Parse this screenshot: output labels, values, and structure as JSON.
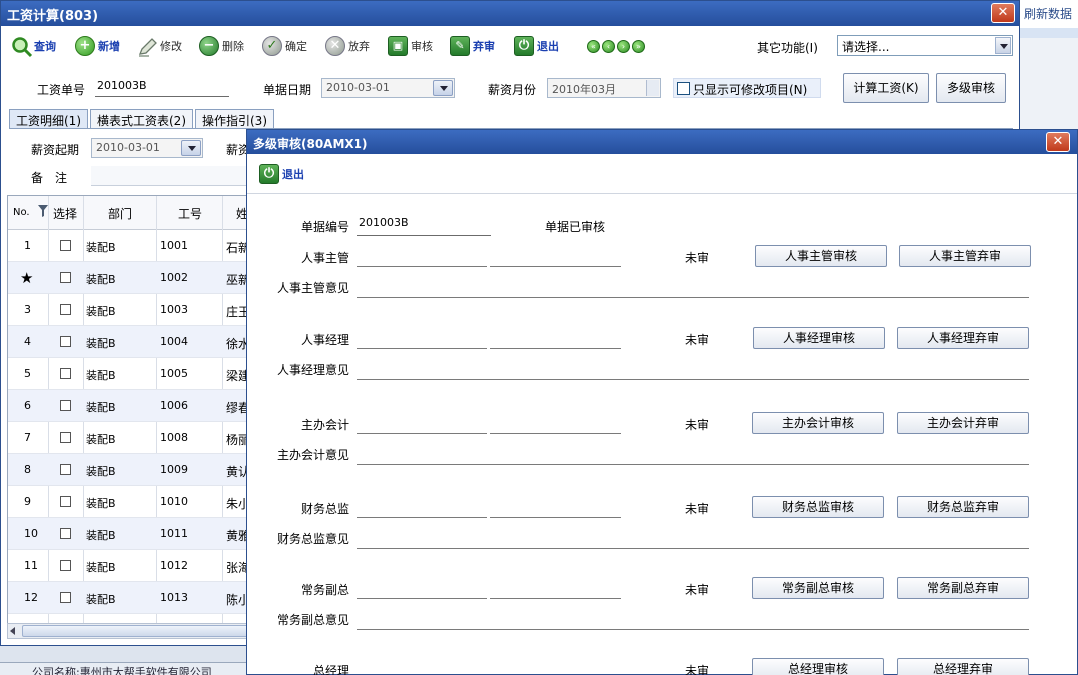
{
  "background": {
    "refresh_label": "刷新数据",
    "status_text": "公司名称:惠州市大帮手软件有限公司"
  },
  "main": {
    "title": "工资计算(803)",
    "close": "✕",
    "toolbar": [
      {
        "key": "query",
        "label": "查询",
        "icon": "search-icon",
        "style": "blue"
      },
      {
        "key": "add",
        "label": "新增",
        "icon": "plus-icon",
        "style": "blue"
      },
      {
        "key": "edit",
        "label": "修改",
        "icon": "pen-icon",
        "style": "grey"
      },
      {
        "key": "delete",
        "label": "删除",
        "icon": "minus-icon",
        "style": "grey"
      },
      {
        "key": "confirm",
        "label": "确定",
        "icon": "check-icon",
        "style": "grey"
      },
      {
        "key": "abandon",
        "label": "放弃",
        "icon": "x-icon",
        "style": "grey"
      },
      {
        "key": "audit",
        "label": "审核",
        "icon": "stamp-icon",
        "style": "grey"
      },
      {
        "key": "unaudit",
        "label": "弃审",
        "icon": "unstamp-icon",
        "style": "blue"
      },
      {
        "key": "exit",
        "label": "退出",
        "icon": "power-icon",
        "style": "blue"
      }
    ],
    "other_functions_label": "其它功能(I)",
    "other_functions_value": "请选择...",
    "form": {
      "doc_no_label": "工资单号",
      "doc_no": "201003B",
      "doc_date_label": "单据日期",
      "doc_date": "2010-03-01",
      "salary_month_label": "薪资月份",
      "salary_month": "2010年03月",
      "only_editable_label": "只显示可修改项目(N)",
      "calc_button": "计算工资(K)",
      "multi_audit_button": "多级审核",
      "start_label": "薪资起期",
      "start_date": "2010-03-01",
      "end_label_partial": "薪资",
      "remark_label": "备　注"
    },
    "tabs": [
      "工资明细(1)",
      "横表式工资表(2)",
      "操作指引(3)"
    ],
    "table": {
      "headers": {
        "no": "No.",
        "select": "选择",
        "dept": "部门",
        "id": "工号",
        "name": "姓"
      },
      "rows": [
        {
          "no": "1",
          "dept": "装配B",
          "id": "1001",
          "name": "石新"
        },
        {
          "no": "★",
          "dept": "装配B",
          "id": "1002",
          "name": "巫新"
        },
        {
          "no": "3",
          "dept": "装配B",
          "id": "1003",
          "name": "庄玉"
        },
        {
          "no": "4",
          "dept": "装配B",
          "id": "1004",
          "name": "徐水"
        },
        {
          "no": "5",
          "dept": "装配B",
          "id": "1005",
          "name": "梁建"
        },
        {
          "no": "6",
          "dept": "装配B",
          "id": "1006",
          "name": "缪春"
        },
        {
          "no": "7",
          "dept": "装配B",
          "id": "1008",
          "name": "杨丽"
        },
        {
          "no": "8",
          "dept": "装配B",
          "id": "1009",
          "name": "黄认"
        },
        {
          "no": "9",
          "dept": "装配B",
          "id": "1010",
          "name": "朱小"
        },
        {
          "no": "10",
          "dept": "装配B",
          "id": "1011",
          "name": "黄雅"
        },
        {
          "no": "11",
          "dept": "装配B",
          "id": "1012",
          "name": "张海"
        },
        {
          "no": "12",
          "dept": "装配B",
          "id": "1013",
          "name": "陈小"
        }
      ]
    }
  },
  "dialog": {
    "title": "多级审核(80AMX1)",
    "close": "✕",
    "exit_label": "退出",
    "doc_no_label": "单据编号",
    "doc_no": "201003B",
    "doc_status": "单据已审核",
    "sections": [
      {
        "role": "人事主管",
        "opinion_label": "人事主管意见",
        "status": "未审",
        "audit_btn": "人事主管审核",
        "unaudit_btn": "人事主管弃审"
      },
      {
        "role": "人事经理",
        "opinion_label": "人事经理意见",
        "status": "未审",
        "audit_btn": "人事经理审核",
        "unaudit_btn": "人事经理弃审"
      },
      {
        "role": "主办会计",
        "opinion_label": "主办会计意见",
        "status": "未审",
        "audit_btn": "主办会计审核",
        "unaudit_btn": "主办会计弃审"
      },
      {
        "role": "财务总监",
        "opinion_label": "财务总监意见",
        "status": "未审",
        "audit_btn": "财务总监审核",
        "unaudit_btn": "财务总监弃审"
      },
      {
        "role": "常务副总",
        "opinion_label": "常务副总意见",
        "status": "未审",
        "audit_btn": "常务副总审核",
        "unaudit_btn": "常务副总弃审"
      },
      {
        "role": "总经理",
        "status": "未审",
        "audit_btn": "总经理审核",
        "unaudit_btn": "总经理弃审"
      }
    ]
  }
}
